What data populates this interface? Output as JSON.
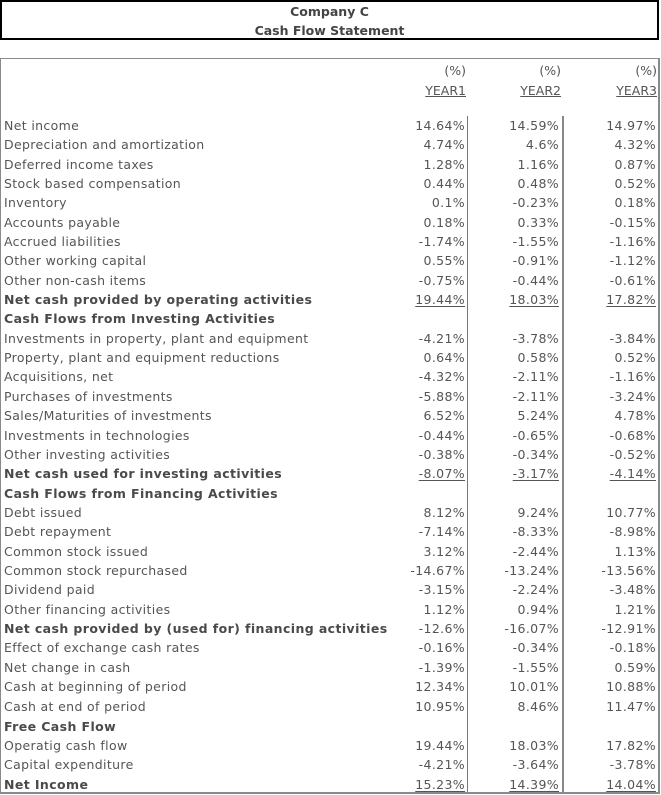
{
  "header": {
    "company": "Company C",
    "statement": "Cash Flow Statement"
  },
  "columns": [
    {
      "unit": "(%)",
      "label": "YEAR1"
    },
    {
      "unit": "(%)",
      "label": "YEAR2"
    },
    {
      "unit": "(%)",
      "label": "YEAR3"
    }
  ],
  "rows": [
    {
      "label": "Net income",
      "values": [
        "14.64%",
        "14.59%",
        "14.97%"
      ],
      "type": "item"
    },
    {
      "label": "Depreciation and amortization",
      "values": [
        "4.74%",
        "4.6%",
        "4.32%"
      ],
      "type": "item"
    },
    {
      "label": "Deferred income taxes",
      "values": [
        "1.28%",
        "1.16%",
        "0.87%"
      ],
      "type": "item"
    },
    {
      "label": "Stock based compensation",
      "values": [
        "0.44%",
        "0.48%",
        "0.52%"
      ],
      "type": "item"
    },
    {
      "label": "Inventory",
      "values": [
        "0.1%",
        "-0.23%",
        "0.18%"
      ],
      "type": "item"
    },
    {
      "label": "Accounts payable",
      "values": [
        "0.18%",
        "0.33%",
        "-0.15%"
      ],
      "type": "item"
    },
    {
      "label": "Accrued liabilities",
      "values": [
        "-1.74%",
        "-1.55%",
        "-1.16%"
      ],
      "type": "item"
    },
    {
      "label": "Other working capital",
      "values": [
        "0.55%",
        "-0.91%",
        "-1.12%"
      ],
      "type": "item"
    },
    {
      "label": "Other non-cash items",
      "values": [
        "-0.75%",
        "-0.44%",
        "-0.61%"
      ],
      "type": "item"
    },
    {
      "label": "Net cash provided by operating activities",
      "values": [
        "19.44%",
        "18.03%",
        "17.82%"
      ],
      "type": "total"
    },
    {
      "label": "Cash Flows from Investing Activities",
      "values": [
        "",
        "",
        ""
      ],
      "type": "section"
    },
    {
      "label": "Investments in property, plant and equipment",
      "values": [
        "-4.21%",
        "-3.78%",
        "-3.84%"
      ],
      "type": "item"
    },
    {
      "label": "Property, plant and equipment reductions",
      "values": [
        "0.64%",
        "0.58%",
        "0.52%"
      ],
      "type": "item"
    },
    {
      "label": "Acquisitions, net",
      "values": [
        "-4.32%",
        "-2.11%",
        "-1.16%"
      ],
      "type": "item"
    },
    {
      "label": "Purchases of investments",
      "values": [
        "-5.88%",
        "-2.11%",
        "-3.24%"
      ],
      "type": "item"
    },
    {
      "label": "Sales/Maturities of investments",
      "values": [
        "6.52%",
        "5.24%",
        "4.78%"
      ],
      "type": "item"
    },
    {
      "label": "Investments in technologies",
      "values": [
        "-0.44%",
        "-0.65%",
        "-0.68%"
      ],
      "type": "item"
    },
    {
      "label": "Other investing activities",
      "values": [
        "-0.38%",
        "-0.34%",
        "-0.52%"
      ],
      "type": "item"
    },
    {
      "label": "Net cash used for investing activities",
      "values": [
        "-8.07%",
        "-3.17%",
        "-4.14%"
      ],
      "type": "total"
    },
    {
      "label": "Cash Flows from Financing Activities",
      "values": [
        "",
        "",
        ""
      ],
      "type": "section"
    },
    {
      "label": "Debt issued",
      "values": [
        "8.12%",
        "9.24%",
        "10.77%"
      ],
      "type": "item"
    },
    {
      "label": "Debt repayment",
      "values": [
        "-7.14%",
        "-8.33%",
        "-8.98%"
      ],
      "type": "item"
    },
    {
      "label": "Common stock issued",
      "values": [
        "3.12%",
        "-2.44%",
        "1.13%"
      ],
      "type": "item"
    },
    {
      "label": "Common stock repurchased",
      "values": [
        "-14.67%",
        "-13.24%",
        "-13.56%"
      ],
      "type": "item"
    },
    {
      "label": "Dividend paid",
      "values": [
        "-3.15%",
        "-2.24%",
        "-3.48%"
      ],
      "type": "item"
    },
    {
      "label": "Other financing activities",
      "values": [
        "1.12%",
        "0.94%",
        "1.21%"
      ],
      "type": "item"
    },
    {
      "label": "Net cash provided by (used for) financing activities",
      "values": [
        "-12.6%",
        "-16.07%",
        "-12.91%"
      ],
      "type": "bold"
    },
    {
      "label": "Effect of exchange cash rates",
      "values": [
        "-0.16%",
        "-0.34%",
        "-0.18%"
      ],
      "type": "item"
    },
    {
      "label": "Net change in cash",
      "values": [
        "-1.39%",
        "-1.55%",
        "0.59%"
      ],
      "type": "item"
    },
    {
      "label": "Cash at beginning of period",
      "values": [
        "12.34%",
        "10.01%",
        "10.88%"
      ],
      "type": "item"
    },
    {
      "label": "Cash at end of period",
      "values": [
        "10.95%",
        "8.46%",
        "11.47%"
      ],
      "type": "item"
    },
    {
      "label": "Free Cash Flow",
      "values": [
        "",
        "",
        ""
      ],
      "type": "section"
    },
    {
      "label": "Operatig cash flow",
      "values": [
        "19.44%",
        "18.03%",
        "17.82%"
      ],
      "type": "item"
    },
    {
      "label": "Capital expenditure",
      "values": [
        "-4.21%",
        "-3.64%",
        "-3.78%"
      ],
      "type": "item"
    },
    {
      "label": "Net Income",
      "values": [
        "15.23%",
        "14.39%",
        "14.04%"
      ],
      "type": "total"
    }
  ]
}
